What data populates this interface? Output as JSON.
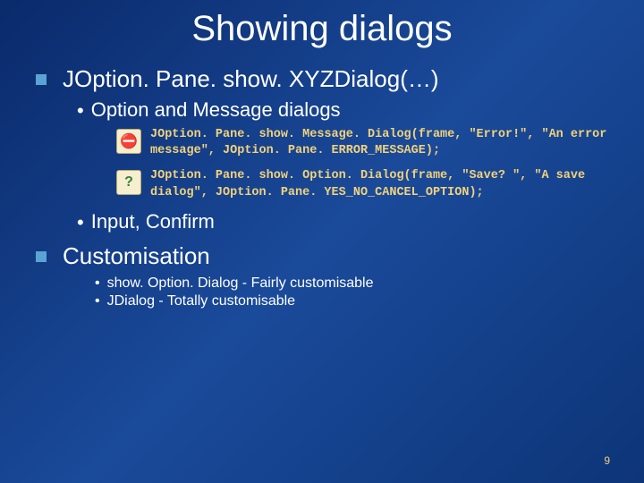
{
  "title": "Showing dialogs",
  "section1": {
    "heading": "JOption. Pane. show. XYZDialog(…)",
    "sub1": "Option and Message dialogs",
    "code1": "JOption. Pane. show. Message. Dialog(frame, \"Error!\", \"An error message\", JOption. Pane. ERROR_MESSAGE);",
    "code2": "JOption. Pane. show. Option. Dialog(frame, \"Save? \", \"A save dialog\", JOption. Pane. YES_NO_CANCEL_OPTION);",
    "sub2": "Input, Confirm"
  },
  "section2": {
    "heading": "Customisation",
    "b1": "show. Option. Dialog - Fairly customisable",
    "b2": "JDialog - Totally customisable"
  },
  "icons": {
    "warn": "⛔",
    "question": "?"
  },
  "page": "9"
}
